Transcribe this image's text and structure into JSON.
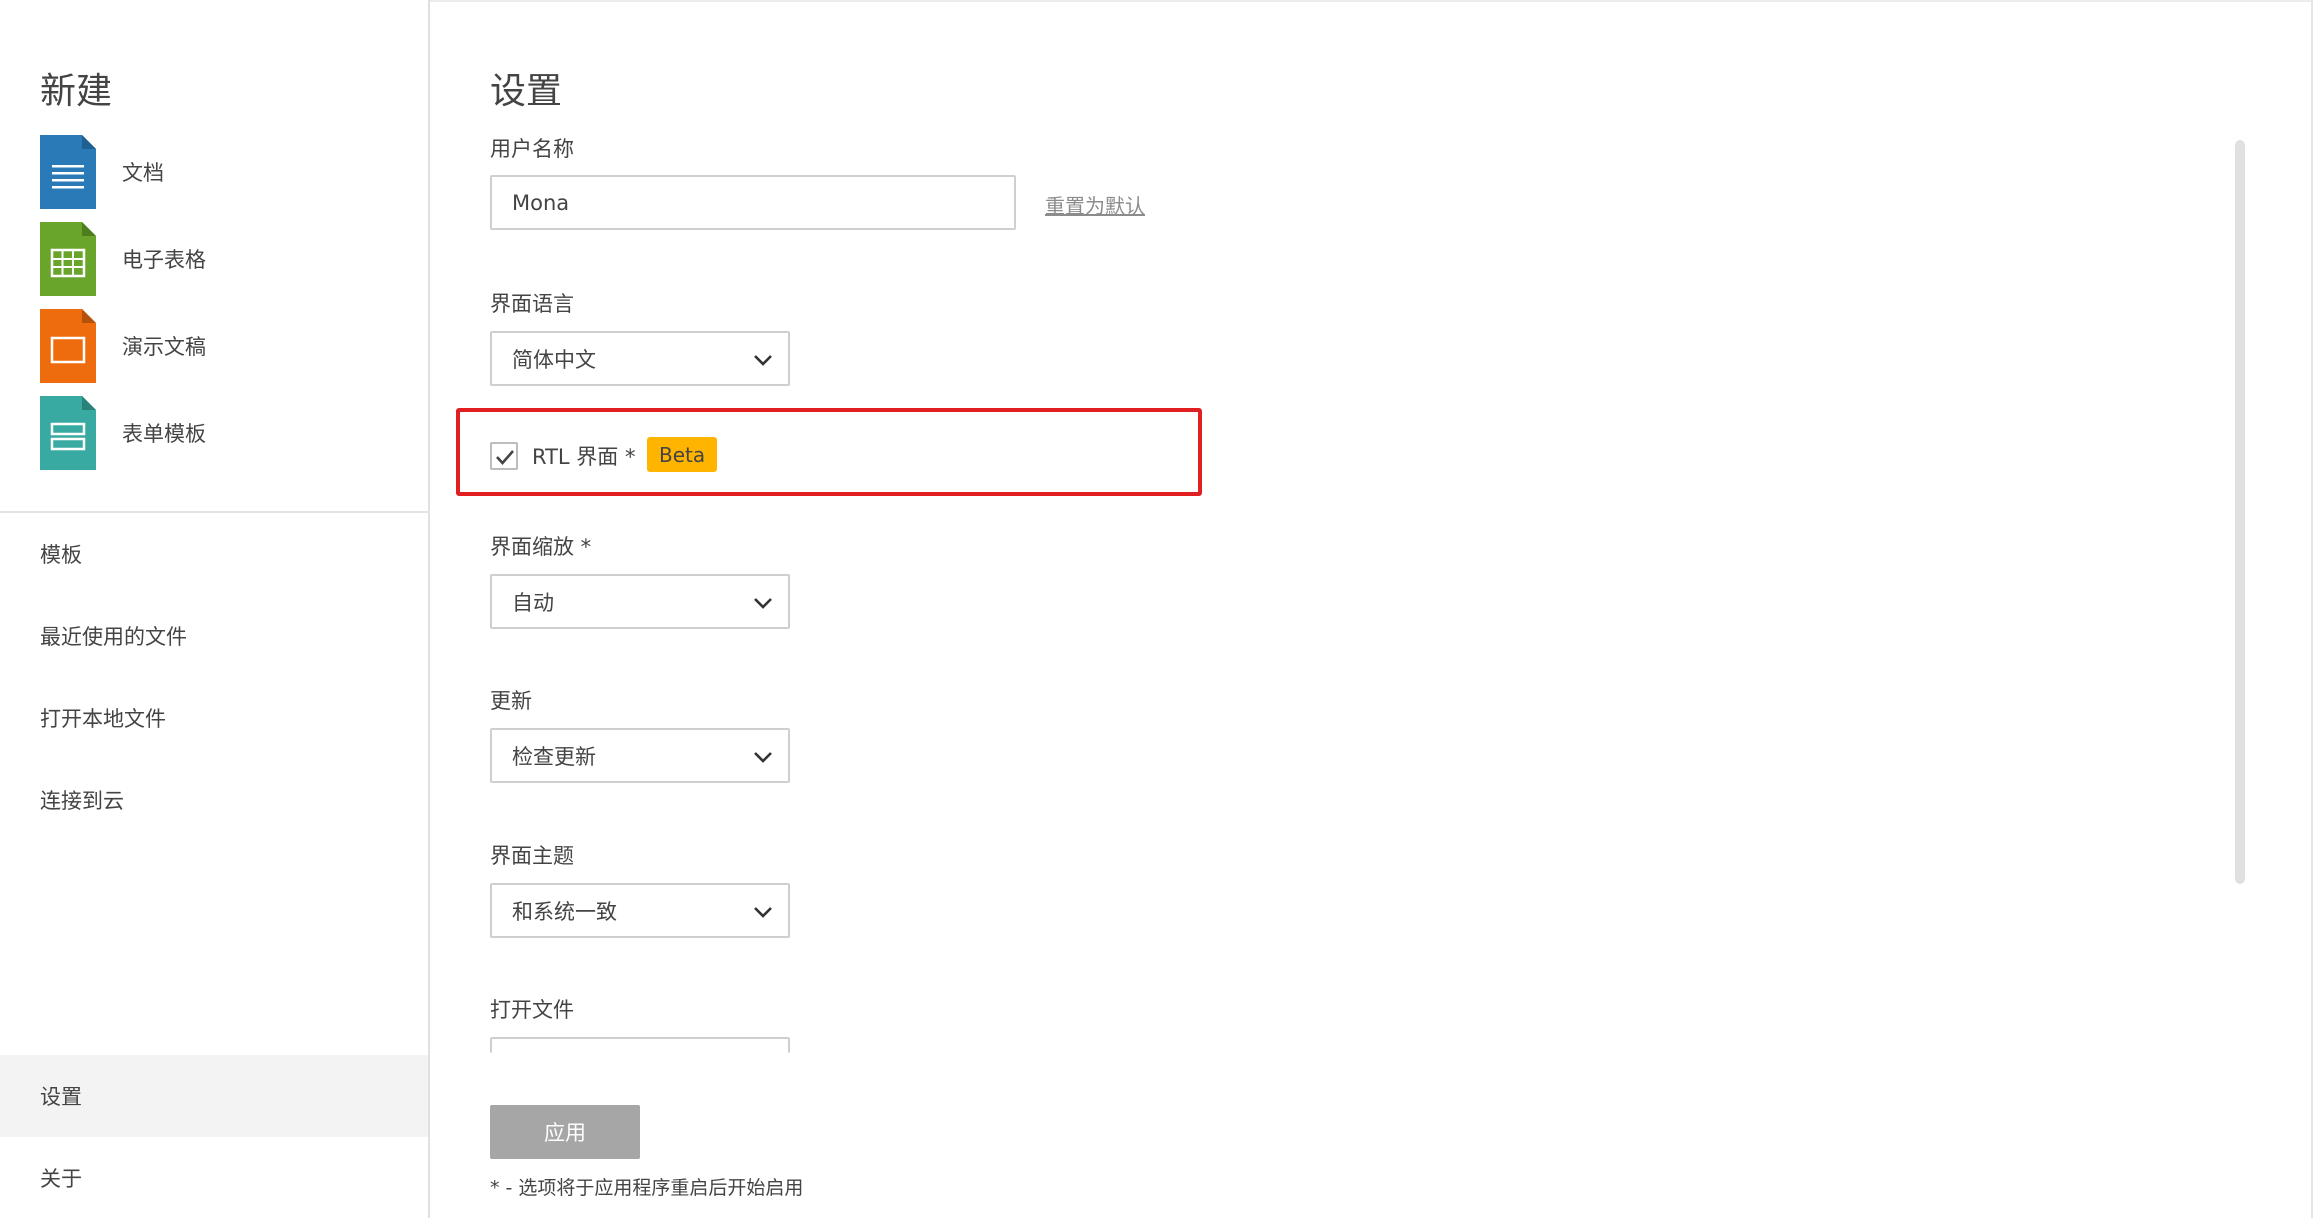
{
  "sidebar": {
    "new_title": "新建",
    "new_items": [
      {
        "label": "文档",
        "icon": "document-icon",
        "color": "#2a7ab8"
      },
      {
        "label": "电子表格",
        "icon": "spreadsheet-icon",
        "color": "#6aa52b"
      },
      {
        "label": "演示文稿",
        "icon": "presentation-icon",
        "color": "#ef6c0e"
      },
      {
        "label": "表单模板",
        "icon": "form-template-icon",
        "color": "#39aaa1"
      }
    ],
    "nav_items": [
      {
        "label": "模板"
      },
      {
        "label": "最近使用的文件"
      },
      {
        "label": "打开本地文件"
      },
      {
        "label": "连接到云"
      }
    ],
    "bottom_items": [
      {
        "label": "设置",
        "active": true
      },
      {
        "label": "关于",
        "active": false
      }
    ]
  },
  "settings": {
    "title": "设置",
    "username": {
      "label": "用户名称",
      "value": "Mona",
      "reset_label": "重置为默认"
    },
    "language": {
      "label": "界面语言",
      "selected": "简体中文"
    },
    "rtl": {
      "label": "RTL 界面 *",
      "badge": "Beta",
      "checked": true
    },
    "scaling": {
      "label": "界面缩放 *",
      "selected": "自动"
    },
    "updates": {
      "label": "更新",
      "selected": "检查更新"
    },
    "theme": {
      "label": "界面主题",
      "selected": "和系统一致"
    },
    "open_file": {
      "label": "打开文件"
    },
    "apply_label": "应用",
    "footnote": "* - 选项将于应用程序重启后开始启用"
  },
  "colors": {
    "highlight_border": "#e02020",
    "beta_badge": "#ffb400",
    "apply_button": "#a6a6a6"
  }
}
